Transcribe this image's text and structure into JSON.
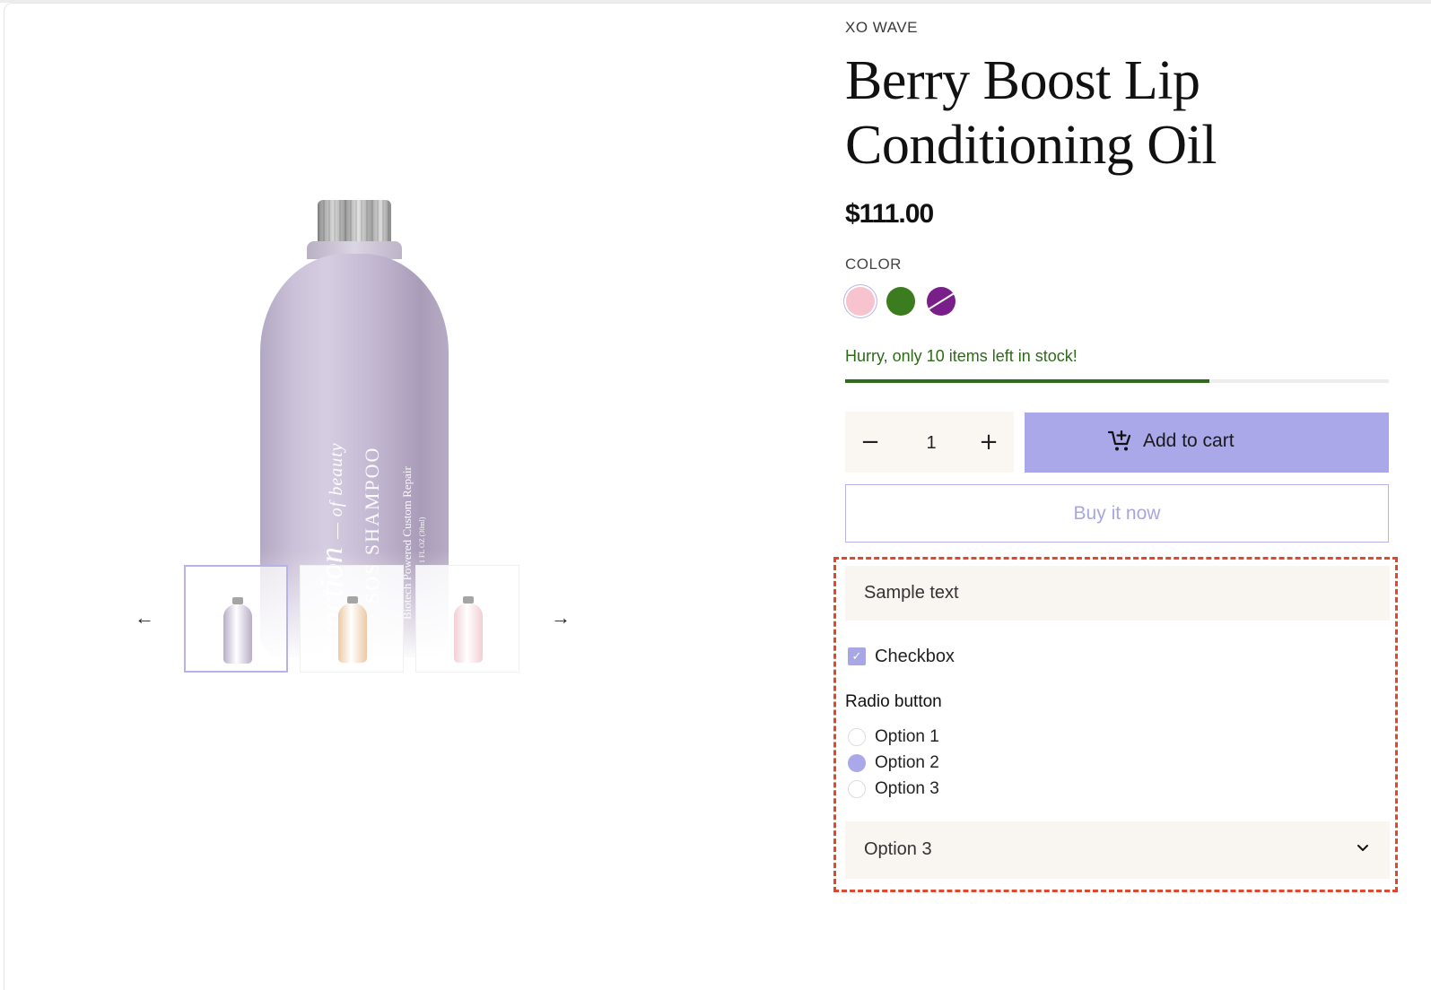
{
  "product": {
    "vendor": "XO WAVE",
    "title": "Berry Boost Lip Conditioning Oil",
    "price": "$111.00",
    "color_label": "COLOR",
    "swatches": [
      {
        "name": "pink",
        "color": "#f6c3cf",
        "selected": true,
        "unavailable": false
      },
      {
        "name": "green",
        "color": "#3b7d1e",
        "selected": false,
        "unavailable": false
      },
      {
        "name": "purple",
        "color": "#7a1f8a",
        "selected": false,
        "unavailable": true
      }
    ],
    "stock_message": "Hurry, only 10 items left in stock!",
    "stock_level": 0.67,
    "quantity": "1",
    "add_to_cart_label": "Add to cart",
    "buy_now_label": "Buy it now"
  },
  "gallery": {
    "image_text": {
      "script": "function",
      "script_sub": "— of beauty",
      "main": "SOS SHAMPOO",
      "sub": "Biotech Powered Custom Repair",
      "size": "1 FL OZ (30ml)"
    },
    "thumbnails": [
      {
        "color": "#b8adc8",
        "active": true
      },
      {
        "color": "#ecc9a6",
        "active": false
      },
      {
        "color": "#f1cfd5",
        "active": false
      }
    ],
    "prev_icon": "arrow-left-icon",
    "next_icon": "arrow-right-icon"
  },
  "custom_fields": {
    "text_value": "Sample text",
    "checkbox_label": "Checkbox",
    "checkbox_checked": true,
    "radio_title": "Radio button",
    "radio_options": [
      "Option 1",
      "Option 2",
      "Option 3"
    ],
    "radio_selected": "Option 2",
    "select_value": "Option 3"
  },
  "colors": {
    "accent": "#aaa8e8",
    "stock_green": "#2d6a18",
    "highlight_border": "#e0482e",
    "field_bg": "#f9f5f1"
  }
}
